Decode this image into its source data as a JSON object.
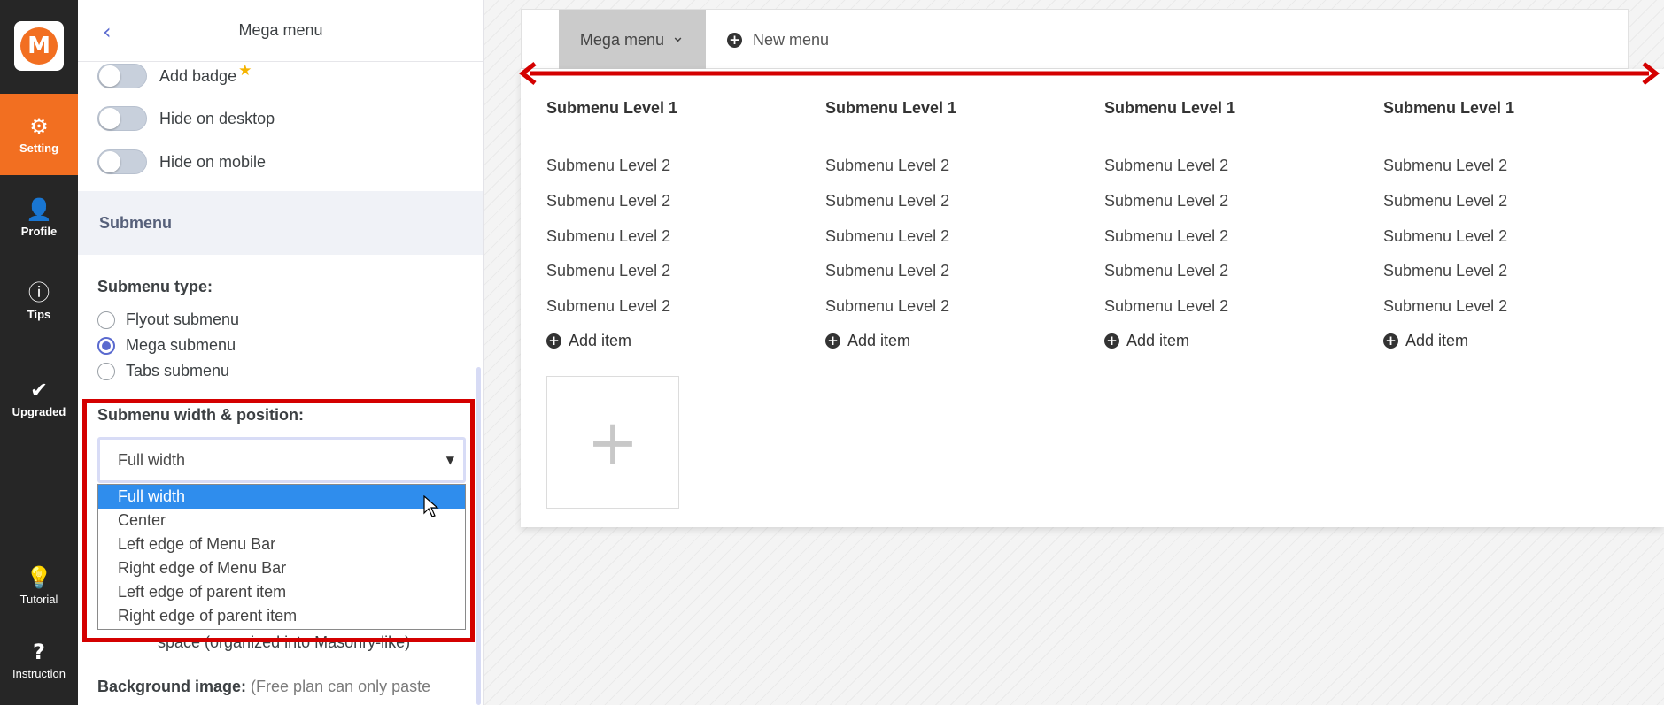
{
  "rail": {
    "logo_letter": "M",
    "items": [
      {
        "label": "Setting",
        "icon": "gear-icon",
        "glyph": "⚙"
      },
      {
        "label": "Profile",
        "icon": "person-icon",
        "glyph": "👤"
      },
      {
        "label": "Tips",
        "icon": "info-icon",
        "glyph": "ⓘ"
      },
      {
        "label": "Upgraded",
        "icon": "checkmark-icon",
        "glyph": "✔"
      },
      {
        "label": "Tutorial",
        "icon": "lightbulb-icon",
        "glyph": "💡"
      },
      {
        "label": "Instruction",
        "icon": "question-icon",
        "glyph": "?"
      }
    ]
  },
  "panel": {
    "title": "Mega menu",
    "back_glyph": "‹",
    "toggles": [
      {
        "label": "Add badge",
        "star": "★"
      },
      {
        "label": "Hide on desktop"
      },
      {
        "label": "Hide on mobile"
      }
    ],
    "section_title": "Submenu",
    "submenu_type_label": "Submenu type:",
    "submenu_types": [
      {
        "label": "Flyout submenu",
        "checked": false
      },
      {
        "label": "Mega submenu",
        "checked": true
      },
      {
        "label": "Tabs submenu",
        "checked": false
      }
    ],
    "width_label": "Submenu width & position:",
    "select_value": "Full width",
    "select_caret": "▼",
    "options": [
      "Full width",
      "Center",
      "Left edge of Menu Bar",
      "Right edge of Menu Bar",
      "Left edge of parent item",
      "Right edge of parent item"
    ],
    "selected_option": "Full width",
    "hidden_text": "space (organized into Masonry-like)",
    "bg_label_bold": "Background image:",
    "bg_label_note": "(Free plan can only paste"
  },
  "preview": {
    "mega_tab": "Mega menu",
    "mega_caret": "⌄",
    "new_tab": "New menu",
    "plus_glyph": "+",
    "columns": [
      {
        "heading": "Submenu Level 1",
        "items": [
          "Submenu Level 2",
          "Submenu Level 2",
          "Submenu Level 2",
          "Submenu Level 2",
          "Submenu Level 2"
        ],
        "add": "Add item"
      },
      {
        "heading": "Submenu Level 1",
        "items": [
          "Submenu Level 2",
          "Submenu Level 2",
          "Submenu Level 2",
          "Submenu Level 2",
          "Submenu Level 2"
        ],
        "add": "Add item"
      },
      {
        "heading": "Submenu Level 1",
        "items": [
          "Submenu Level 2",
          "Submenu Level 2",
          "Submenu Level 2",
          "Submenu Level 2",
          "Submenu Level 2"
        ],
        "add": "Add item"
      },
      {
        "heading": "Submenu Level 1",
        "items": [
          "Submenu Level 2",
          "Submenu Level 2",
          "Submenu Level 2",
          "Submenu Level 2",
          "Submenu Level 2"
        ],
        "add": "Add item"
      }
    ],
    "add_column_glyph": "+"
  },
  "colors": {
    "accent": "#f26f21",
    "rail_bg": "#262626",
    "highlight_red": "#d40000",
    "selection_blue": "#2f8ded",
    "radio_purple": "#5a6acf"
  }
}
